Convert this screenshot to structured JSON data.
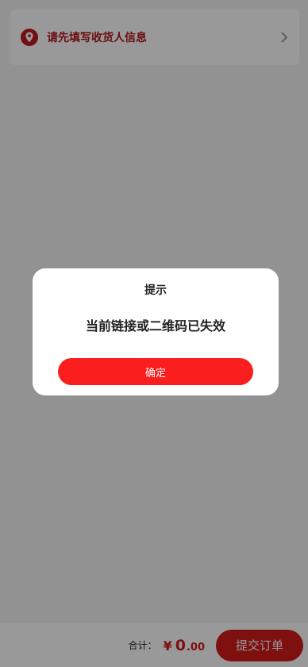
{
  "address": {
    "placeholder_text": "请先填写收货人信息",
    "location_icon": "location-pin-icon",
    "chevron_icon": "chevron-right-icon"
  },
  "footer": {
    "total_label": "合计：",
    "currency": "¥",
    "price_int": "0",
    "price_dec": ".00",
    "submit_label": "提交订单"
  },
  "modal": {
    "title": "提示",
    "message": "当前链接或二维码已失效",
    "confirm_label": "确定"
  },
  "colors": {
    "brand_red": "#d31b1b",
    "confirm_red": "#fb1e1f",
    "overlay": "rgba(0,0,0,0.4)"
  }
}
